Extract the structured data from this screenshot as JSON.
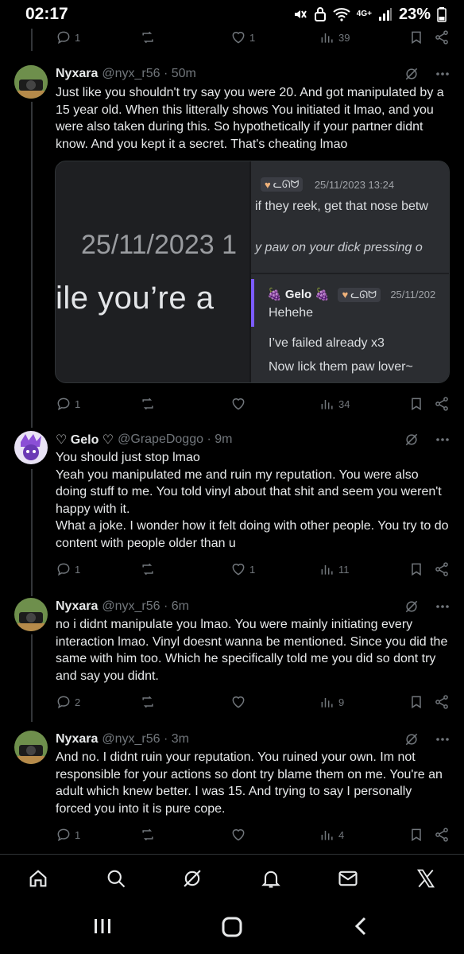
{
  "status_bar": {
    "time": "02:17",
    "battery": "23%",
    "network": "4G+"
  },
  "top_actions": {
    "replies": "1",
    "likes": "1",
    "views": "39"
  },
  "tweets": [
    {
      "name": "Nyxara",
      "handle": "@nyx_r56 · 50m",
      "text": "Just like you shouldn't try say you were 20. And got manipulated by a 15 year old. When this litterally shows You initiated it lmao, and you were also taken during this. So hypothetically if your partner didnt know. And you kept it a secret. That's cheating lmao",
      "replies": "1",
      "retweets": "",
      "likes": "",
      "views": "34"
    },
    {
      "name": "♡ Gelo ♡",
      "handle": "@GrapeDoggo · 9m",
      "lines": [
        "You should just stop lmao",
        "Yeah you manipulated me and ruin my reputation. You were also doing stuff to me. You told vinyl about that shit and seem you weren't happy with it.",
        "What a joke. I wonder how it felt doing with other people. You try to do content with people older than u"
      ],
      "replies": "1",
      "retweets": "",
      "likes": "1",
      "views": "11"
    },
    {
      "name": "Nyxara",
      "handle": "@nyx_r56 · 6m",
      "text": "no i didnt manipulate you lmao. You were mainly initiating every interaction lmao. Vinyl doesnt wanna be mentioned. Since you did the same with him too. Which he specifically told me you did so dont try and say you didnt.",
      "replies": "2",
      "retweets": "",
      "likes": "",
      "views": "9"
    },
    {
      "name": "Nyxara",
      "handle": "@nyx_r56 · 3m",
      "text": "And no. I didnt ruin your reputation. You ruined your own. Im not responsible for your actions so dont try blame them on me. You're an adult which knew better. I was 15. And trying to say I personally forced you into it is pure cope.",
      "replies": "1",
      "retweets": "",
      "likes": "",
      "views": "4"
    }
  ],
  "media": {
    "big_date": "25/11/2023 1",
    "big_quote": "ile you’re a",
    "tag_text": "ᓚᘏᗢ",
    "msg1_date": "25/11/2023 13:24",
    "msg1_line1": "if they reek, get that nose betw",
    "msg1_line2": "y paw on your dick pressing o",
    "msg2_name": "🍇 Gelo 🍇",
    "msg2_date": "25/11/202",
    "msg2_line1": "Hehehe",
    "msg2_line2": "I’ve failed already x3",
    "msg2_line3": "Now lick them paw lover~"
  },
  "icons": {
    "reply": "reply-icon",
    "retweet": "retweet-icon",
    "like": "heart-icon",
    "views": "views-icon",
    "bookmark": "bookmark-icon",
    "share": "share-icon",
    "grok": "grok-icon",
    "more": "more-icon"
  },
  "nav": [
    "home-icon",
    "search-icon",
    "grok-icon",
    "notifications-icon",
    "messages-icon",
    "x-logo-icon"
  ]
}
